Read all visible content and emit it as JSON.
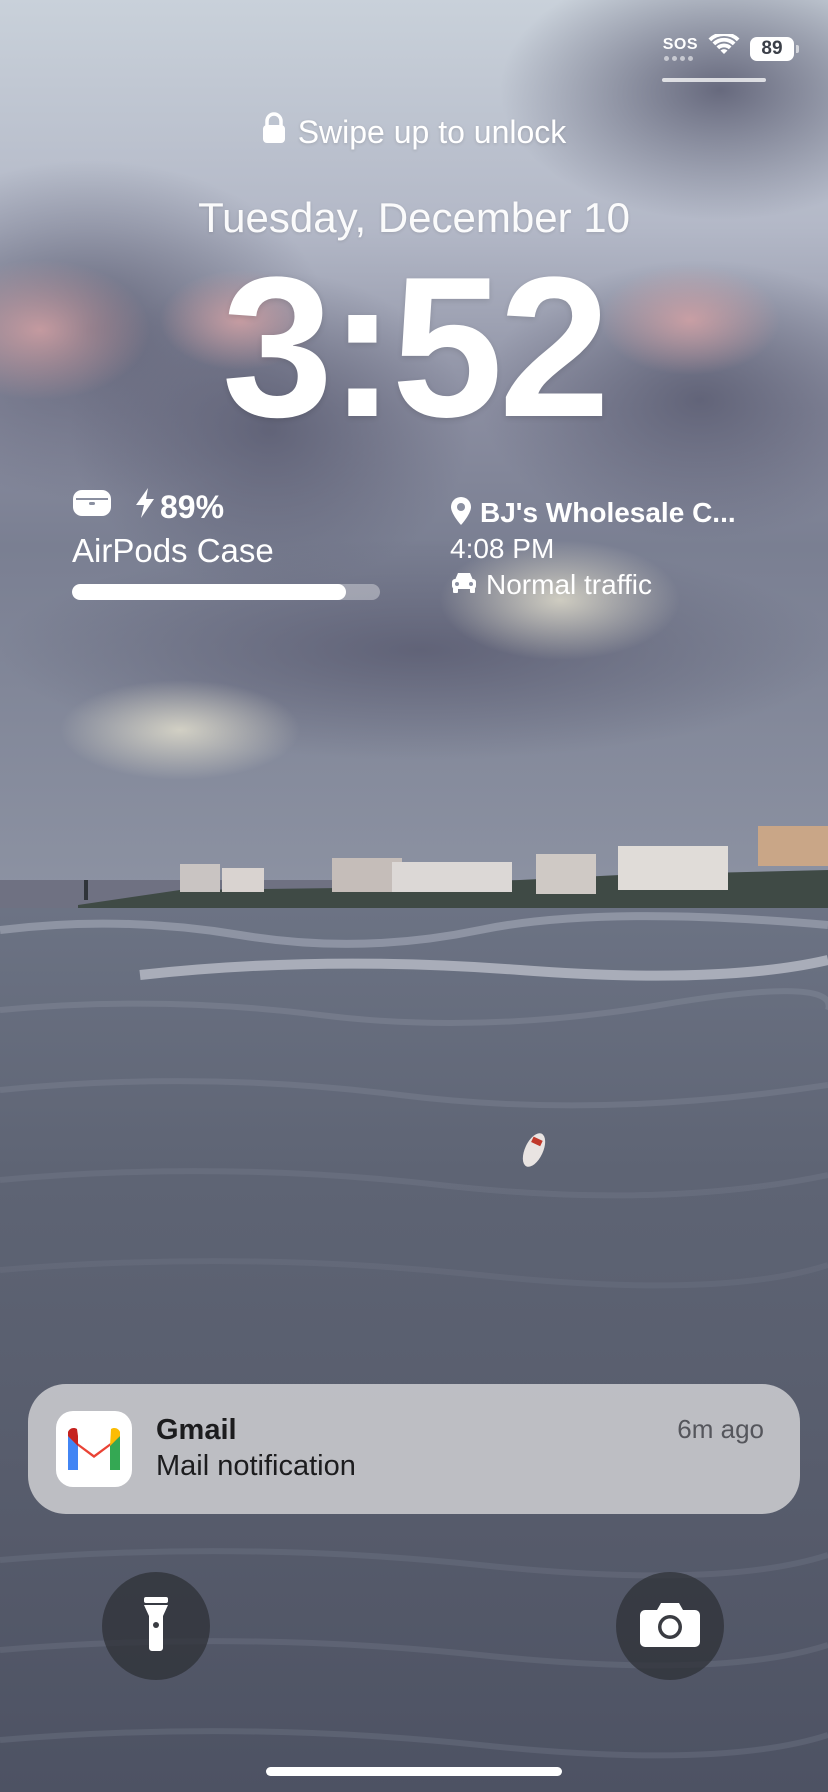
{
  "status_bar": {
    "sos": "SOS",
    "battery": "89"
  },
  "lock_screen": {
    "unlock_hint": "Swipe up to unlock",
    "date": "Tuesday, December 10",
    "time": "3:52"
  },
  "airpods_widget": {
    "battery_percent": "89%",
    "battery_level": 0.89,
    "device_name": "AirPods Case"
  },
  "maps_widget": {
    "destination": "BJ's Wholesale C...",
    "eta": "4:08 PM",
    "traffic": "Normal traffic"
  },
  "notification": {
    "app": "Gmail",
    "body": "Mail notification",
    "time": "6m ago",
    "icon": "gmail-icon"
  },
  "quick_actions": {
    "left_icon": "flashlight-icon",
    "right_icon": "camera-icon"
  },
  "colors": {
    "gmail_red": "#EA4335",
    "gmail_blue": "#4285F4",
    "gmail_green": "#34A853",
    "gmail_yellow": "#FBBC04"
  }
}
